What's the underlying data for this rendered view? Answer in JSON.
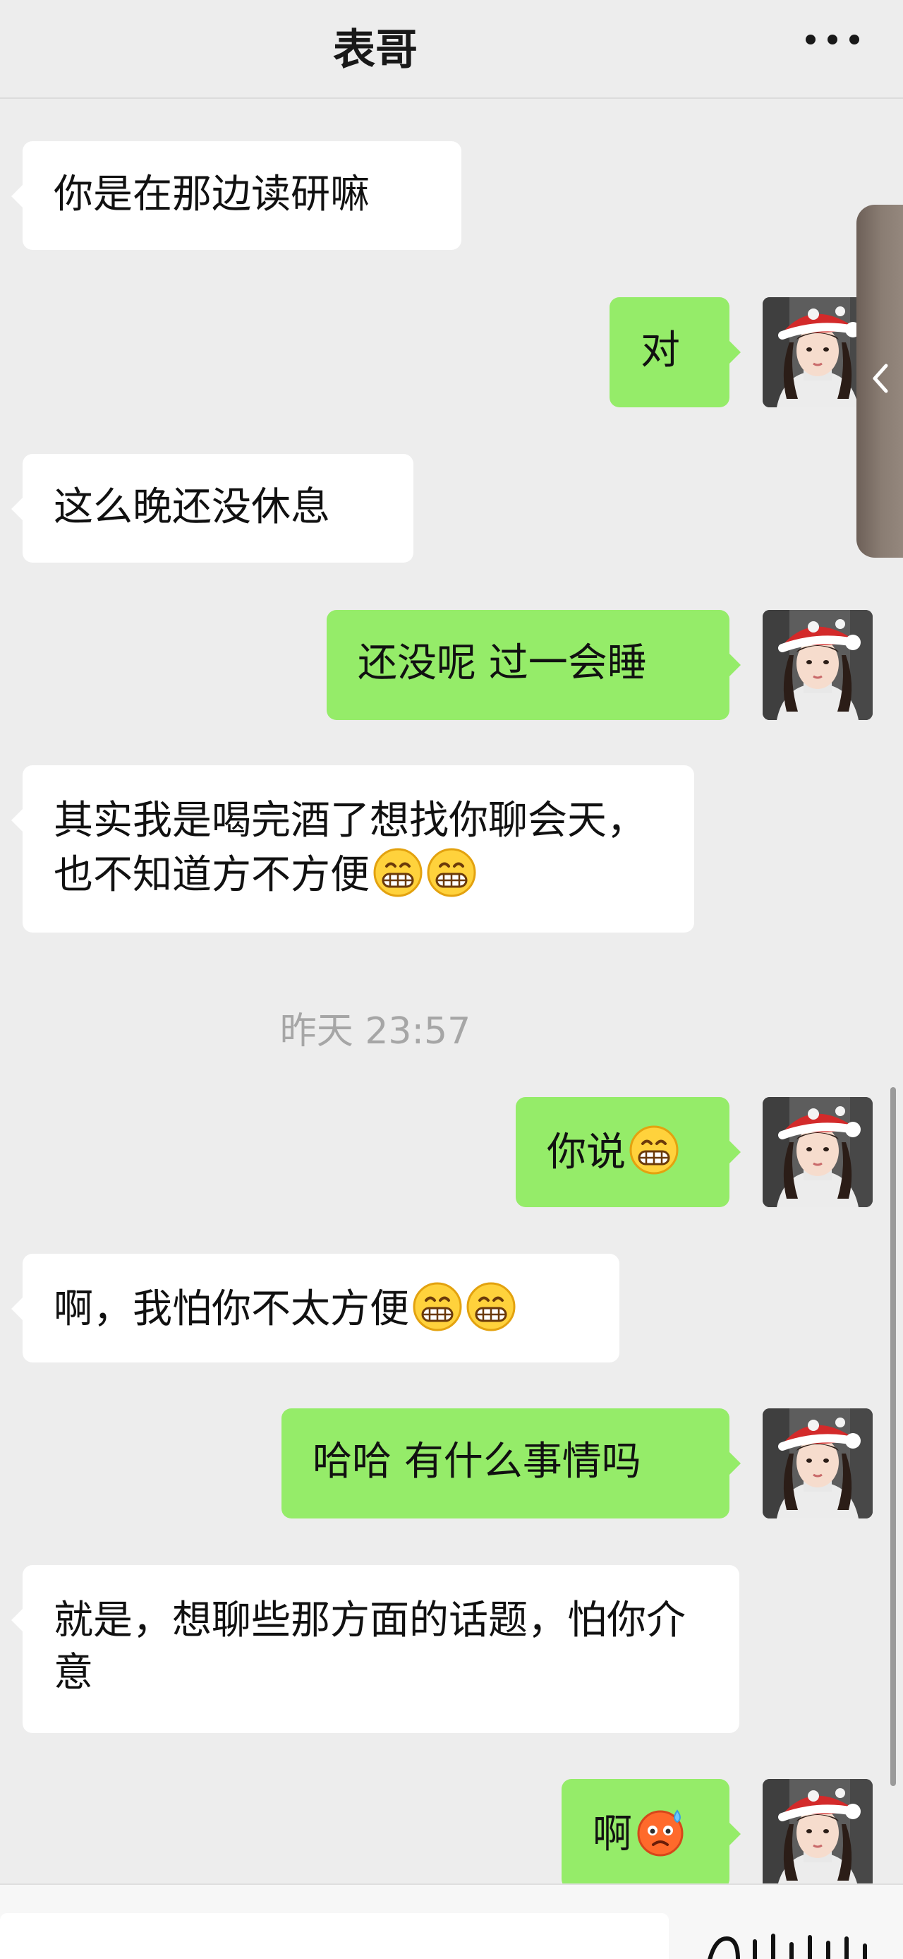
{
  "header": {
    "title": "表哥",
    "more_icon": "more-dots-icon"
  },
  "messages": [
    {
      "side": "left",
      "text": "你是在那边读研嘛"
    },
    {
      "side": "right",
      "text": "对"
    },
    {
      "side": "left",
      "text": "这么晚还没休息"
    },
    {
      "side": "right",
      "text": "还没呢 过一会睡"
    },
    {
      "side": "left",
      "text": "其实我是喝完酒了想找你聊会天，也不知道方不方便",
      "emojis": [
        "grimacing-emoji",
        "grimacing-emoji"
      ]
    },
    {
      "side": "right",
      "text": "你说",
      "emojis": [
        "grimacing-emoji"
      ]
    },
    {
      "side": "left",
      "text": "啊，我怕你不太方便",
      "emojis": [
        "grimacing-emoji",
        "grimacing-emoji"
      ]
    },
    {
      "side": "right",
      "text": "哈哈 有什么事情吗"
    },
    {
      "side": "left",
      "text": "就是，想聊些那方面的话题，怕你介意"
    },
    {
      "side": "right",
      "text": "啊",
      "emojis": [
        "cold-sweat-emoji"
      ]
    }
  ],
  "timestamp": "昨天 23:57",
  "colors": {
    "background": "#ededed",
    "bubble_self": "#95ec69",
    "bubble_other": "#ffffff",
    "timestamp_text": "#a6a6a6"
  },
  "icons": {
    "side_handle": "chevron-left-icon",
    "bottom_voice": "voice-wave-icon"
  }
}
